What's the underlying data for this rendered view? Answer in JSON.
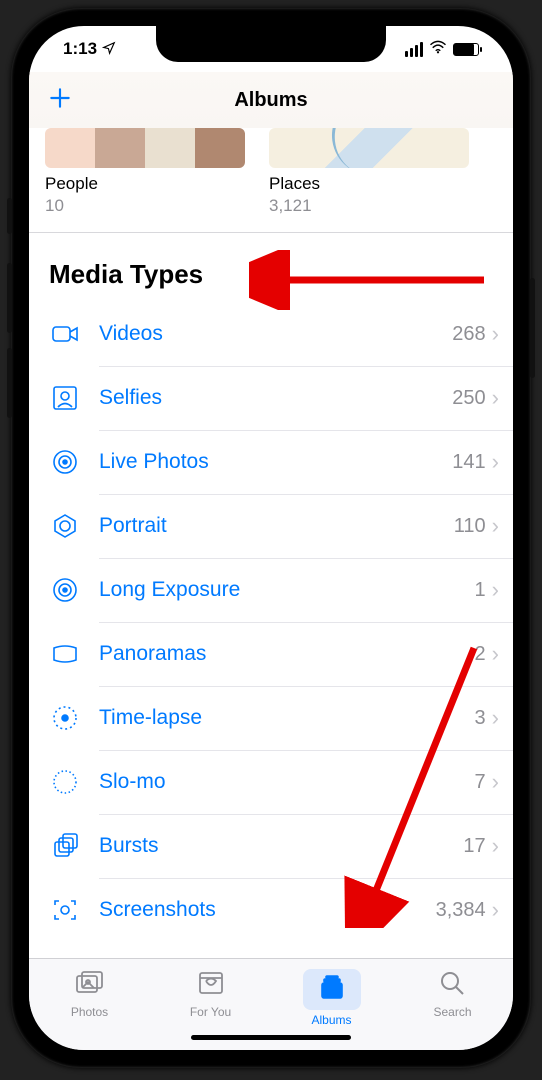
{
  "status": {
    "time": "1:13"
  },
  "nav": {
    "title": "Albums"
  },
  "albums_strip": [
    {
      "name": "People",
      "count": "10"
    },
    {
      "name": "Places",
      "count": "3,121"
    }
  ],
  "section": {
    "title": "Media Types"
  },
  "media_types": [
    {
      "icon": "video-icon",
      "label": "Videos",
      "count": "268"
    },
    {
      "icon": "selfie-icon",
      "label": "Selfies",
      "count": "250"
    },
    {
      "icon": "livephoto-icon",
      "label": "Live Photos",
      "count": "141"
    },
    {
      "icon": "portrait-icon",
      "label": "Portrait",
      "count": "110"
    },
    {
      "icon": "longexposure-icon",
      "label": "Long Exposure",
      "count": "1"
    },
    {
      "icon": "panorama-icon",
      "label": "Panoramas",
      "count": "2"
    },
    {
      "icon": "timelapse-icon",
      "label": "Time-lapse",
      "count": "3"
    },
    {
      "icon": "slomo-icon",
      "label": "Slo-mo",
      "count": "7"
    },
    {
      "icon": "bursts-icon",
      "label": "Bursts",
      "count": "17"
    },
    {
      "icon": "screenshots-icon",
      "label": "Screenshots",
      "count": "3,384"
    }
  ],
  "tabs": [
    {
      "label": "Photos"
    },
    {
      "label": "For You"
    },
    {
      "label": "Albums"
    },
    {
      "label": "Search"
    }
  ]
}
